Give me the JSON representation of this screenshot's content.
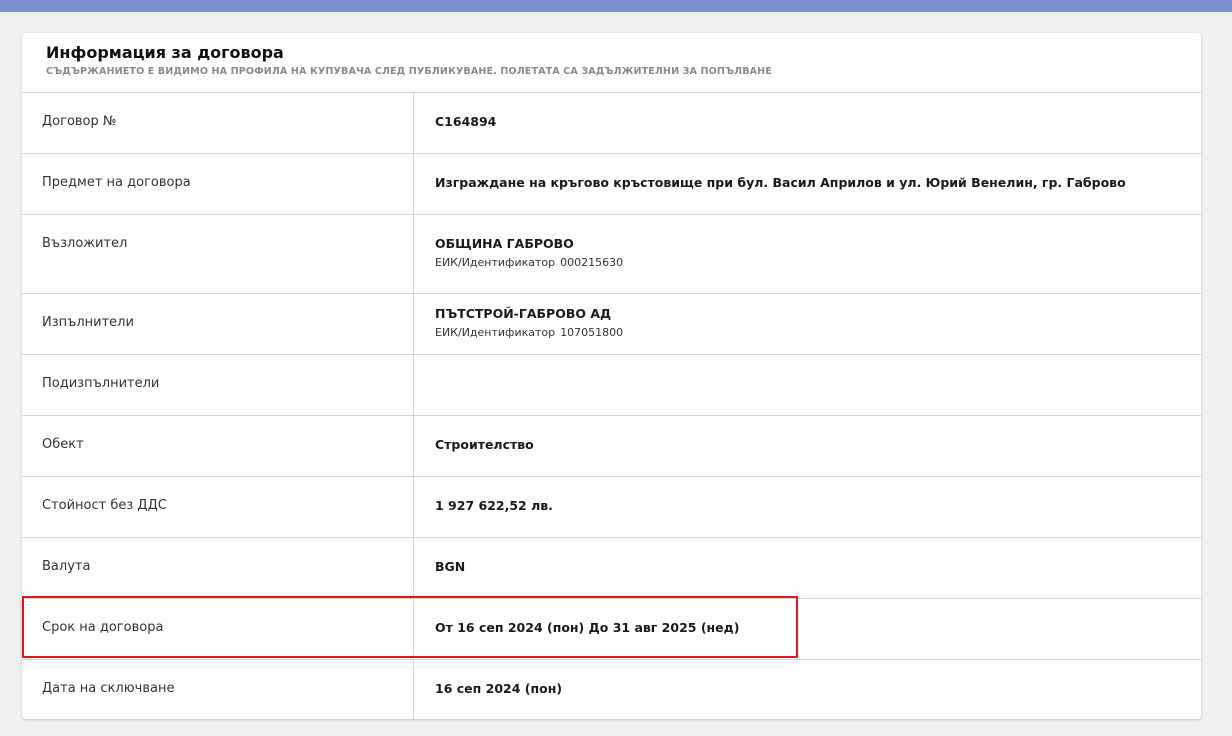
{
  "header": {
    "title": "Информация за договора",
    "subtitle": "СЪДЪРЖАНИЕТО Е ВИДИМО НА ПРОФИЛА НА КУПУВАЧА СЛЕД ПУБЛИКУВАНЕ. ПОЛЕТАТА СА ЗАДЪЛЖИТЕЛНИ ЗА ПОПЪЛВАНЕ"
  },
  "rows": {
    "contract_no": {
      "label": "Договор №",
      "value": "C164894"
    },
    "subject": {
      "label": "Предмет на договора",
      "value": "Изграждане на кръгово кръстовище при бул. Васил Априлов и ул. Юрий Венелин, гр. Габрово"
    },
    "contracting_authority": {
      "label": "Възложител",
      "value": "ОБЩИНА ГАБРОВО",
      "id_label": "ЕИК/Идентификатор",
      "id_value": "000215630"
    },
    "contractors": {
      "label": "Изпълнители",
      "value": "ПЪТСТРОЙ-ГАБРОВО АД",
      "id_label": "ЕИК/Идентификатор",
      "id_value": "107051800"
    },
    "subcontractors": {
      "label": "Подизпълнители",
      "value": ""
    },
    "object": {
      "label": "Обект",
      "value": "Строителство"
    },
    "value_excl_vat": {
      "label": "Стойност без ДДС",
      "value": "1 927 622,52 лв."
    },
    "currency": {
      "label": "Валута",
      "value": "BGN"
    },
    "term": {
      "label": "Срок на договора",
      "value": "От 16 сеп 2024 (пон) До 31 авг 2025 (нед)"
    },
    "conclusion_date": {
      "label": "Дата на сключване",
      "value": "16 сеп 2024 (пон)"
    }
  },
  "colors": {
    "top_bar": "#7b93d3",
    "highlight": "#e0191f",
    "background": "#f1f1f2"
  }
}
